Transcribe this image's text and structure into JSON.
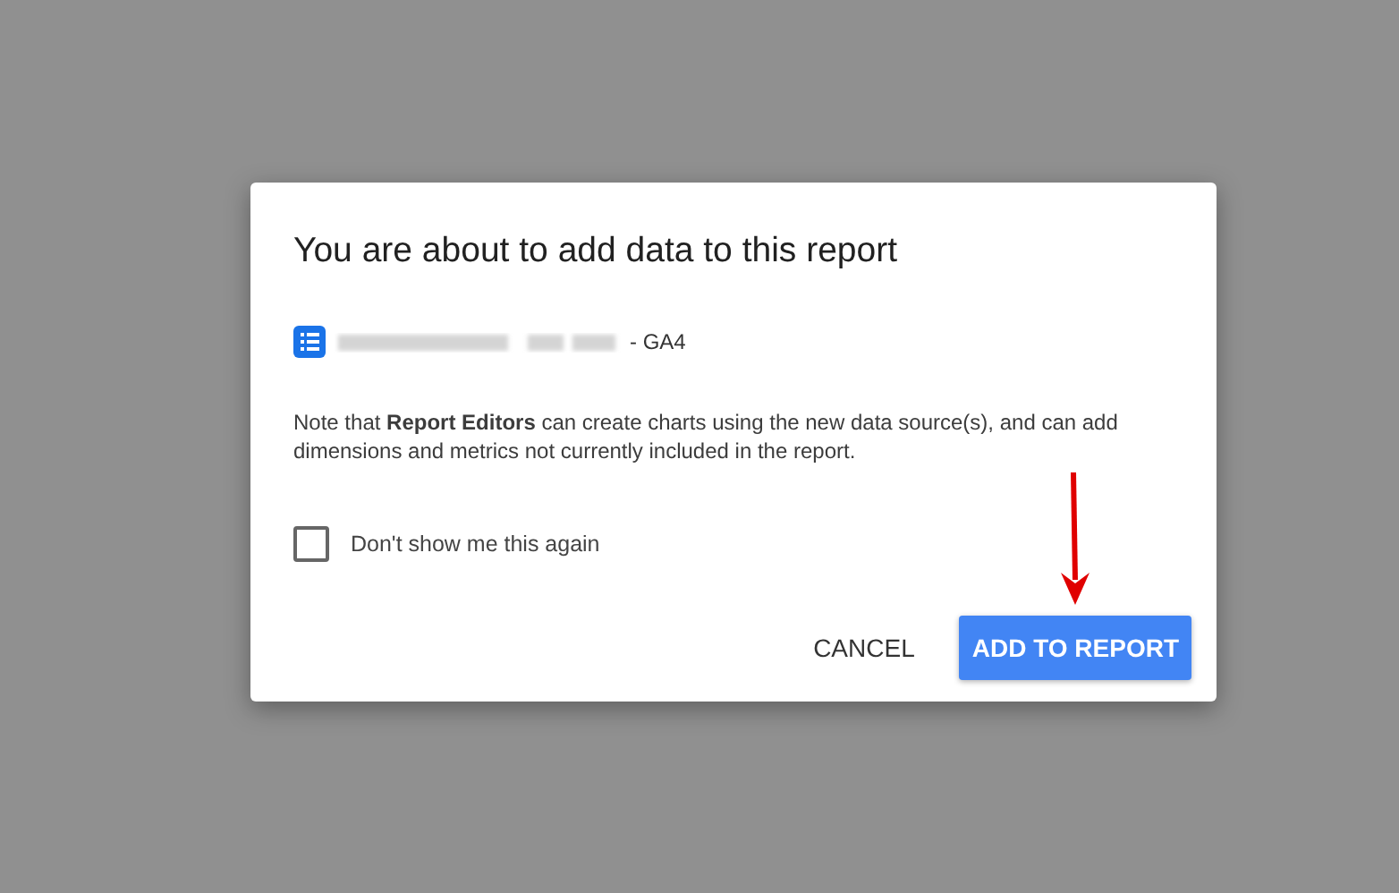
{
  "dialog": {
    "title": "You are about to add data to this report",
    "source": {
      "name_suffix": "- GA4"
    },
    "note": "Note that **Report Editors** can create charts using the new data source(s), and can add dimensions and metrics not currently included in the report.",
    "checkbox": {
      "label": "Don't show me this again",
      "checked": false
    },
    "buttons": [
      {
        "label": "CANCEL",
        "kind": "text"
      },
      {
        "label": "ADD TO REPORT",
        "kind": "primary"
      }
    ]
  }
}
